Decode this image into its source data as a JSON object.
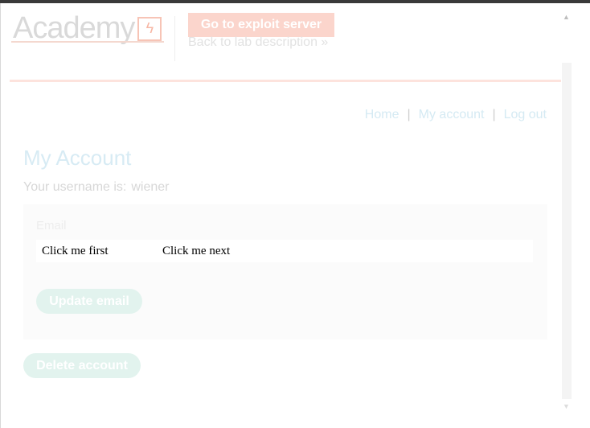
{
  "header": {
    "logo_text": "Academy",
    "logo_mark": "ϟ",
    "exploit_button": "Go to exploit server",
    "back_link": "Back to lab description  »"
  },
  "nav": {
    "home": "Home",
    "separator": "|",
    "my_account": "My account",
    "log_out": "Log out"
  },
  "account": {
    "title": "My Account",
    "username_label": "Your username is:",
    "username": "wiener",
    "email_label": "Email",
    "update_button": "Update email",
    "delete_button": "Delete account"
  },
  "decoys": {
    "first": "Click me first",
    "next": "Click me next"
  },
  "colors": {
    "accent": "#fbd5cc",
    "link": "#d5eaf3",
    "button": "#e2f3ee"
  }
}
